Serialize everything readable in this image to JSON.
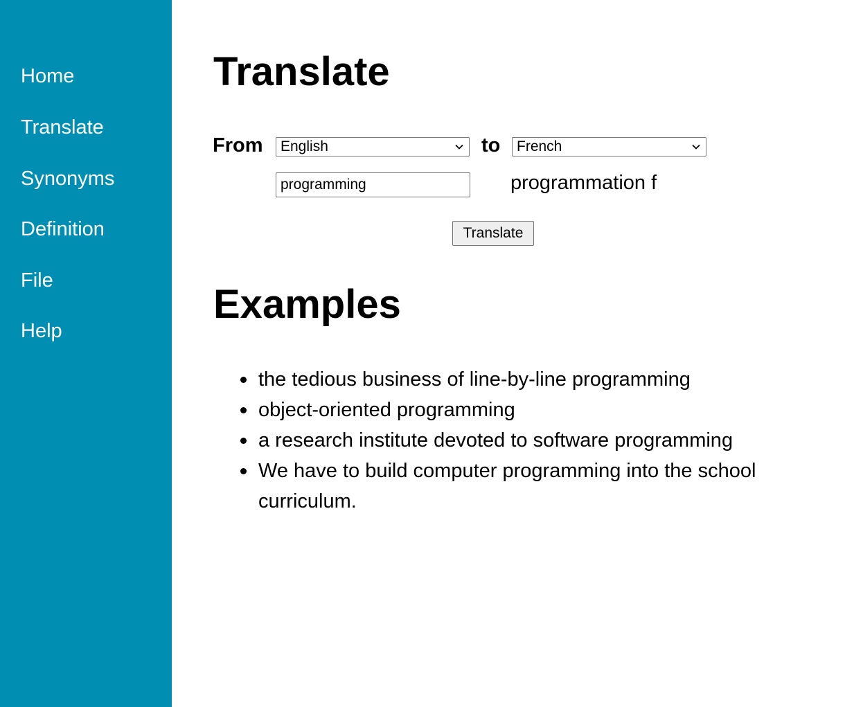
{
  "sidebar": {
    "items": [
      {
        "label": "Home"
      },
      {
        "label": "Translate"
      },
      {
        "label": "Synonyms"
      },
      {
        "label": "Definition"
      },
      {
        "label": "File"
      },
      {
        "label": "Help"
      }
    ]
  },
  "main": {
    "title": "Translate",
    "from_label": "From",
    "to_label": "to",
    "from_language": "English",
    "to_language": "French",
    "input_value": "programming",
    "output_text": "programmation f",
    "translate_button": "Translate",
    "examples_title": "Examples",
    "examples": [
      "the tedious business of line-by-line programming",
      "object-oriented programming",
      "a research institute devoted to software programming",
      "We have to build computer programming into the school curriculum."
    ]
  },
  "colors": {
    "sidebar_bg": "#008fb3",
    "sidebar_text": "#ffffff"
  },
  "icons": {
    "dropdown": "chevron-down-icon"
  }
}
